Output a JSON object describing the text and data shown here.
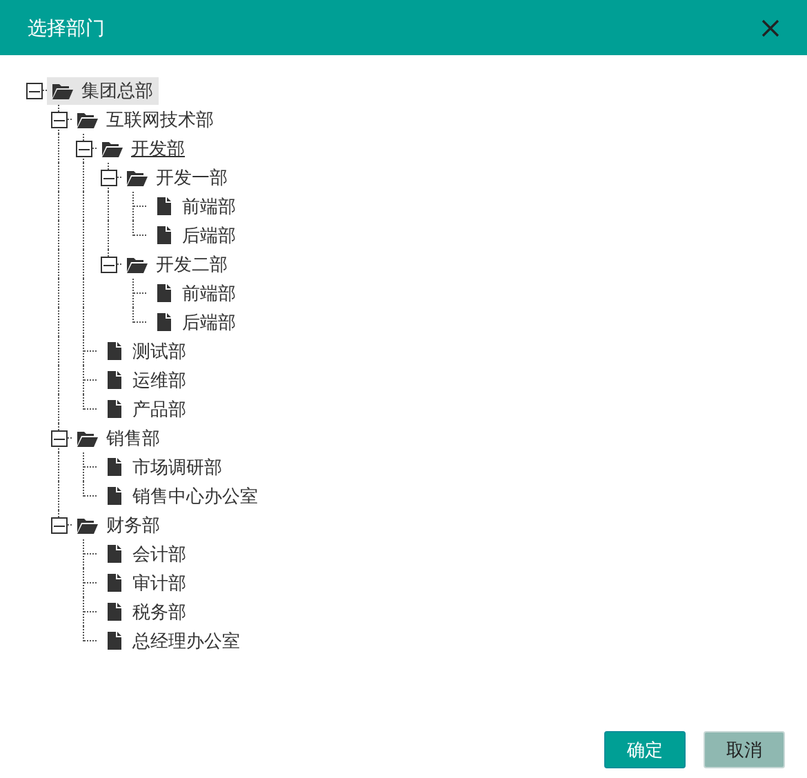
{
  "dialog": {
    "title": "选择部门"
  },
  "tree": [
    {
      "label": "集团总部",
      "kind": "folder",
      "selected": true,
      "hovered": false,
      "expanded": true,
      "children": [
        {
          "label": "互联网技术部",
          "kind": "folder",
          "selected": false,
          "hovered": false,
          "expanded": true,
          "children": [
            {
              "label": "开发部",
              "kind": "folder",
              "selected": false,
              "hovered": true,
              "expanded": true,
              "children": [
                {
                  "label": "开发一部",
                  "kind": "folder",
                  "selected": false,
                  "hovered": false,
                  "expanded": true,
                  "children": [
                    {
                      "label": "前端部",
                      "kind": "file",
                      "selected": false,
                      "hovered": false
                    },
                    {
                      "label": "后端部",
                      "kind": "file",
                      "selected": false,
                      "hovered": false
                    }
                  ]
                },
                {
                  "label": "开发二部",
                  "kind": "folder",
                  "selected": false,
                  "hovered": false,
                  "expanded": true,
                  "children": [
                    {
                      "label": "前端部",
                      "kind": "file",
                      "selected": false,
                      "hovered": false
                    },
                    {
                      "label": "后端部",
                      "kind": "file",
                      "selected": false,
                      "hovered": false
                    }
                  ]
                }
              ]
            },
            {
              "label": "测试部",
              "kind": "file",
              "selected": false,
              "hovered": false
            },
            {
              "label": "运维部",
              "kind": "file",
              "selected": false,
              "hovered": false
            },
            {
              "label": "产品部",
              "kind": "file",
              "selected": false,
              "hovered": false
            }
          ]
        },
        {
          "label": "销售部",
          "kind": "folder",
          "selected": false,
          "hovered": false,
          "expanded": true,
          "children": [
            {
              "label": "市场调研部",
              "kind": "file",
              "selected": false,
              "hovered": false
            },
            {
              "label": "销售中心办公室",
              "kind": "file",
              "selected": false,
              "hovered": false
            }
          ]
        },
        {
          "label": "财务部",
          "kind": "folder",
          "selected": false,
          "hovered": false,
          "expanded": true,
          "children": [
            {
              "label": "会计部",
              "kind": "file",
              "selected": false,
              "hovered": false
            },
            {
              "label": "审计部",
              "kind": "file",
              "selected": false,
              "hovered": false
            },
            {
              "label": "税务部",
              "kind": "file",
              "selected": false,
              "hovered": false
            },
            {
              "label": "总经理办公室",
              "kind": "file",
              "selected": false,
              "hovered": false
            }
          ]
        }
      ]
    }
  ],
  "buttons": [
    {
      "label": "确定",
      "kind": "primary"
    },
    {
      "label": "取消",
      "kind": "secondary"
    }
  ]
}
